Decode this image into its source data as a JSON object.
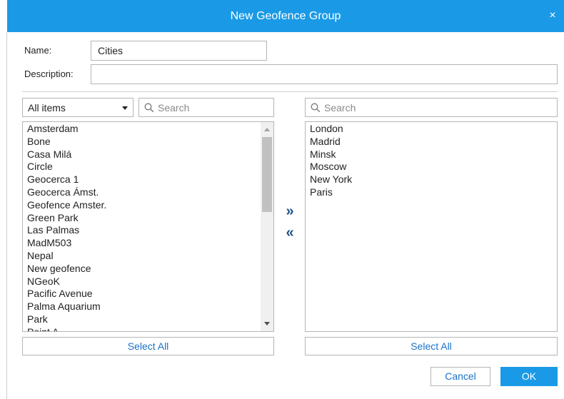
{
  "dialog": {
    "title": "New Geofence Group",
    "close_glyph": "×"
  },
  "form": {
    "name_label": "Name:",
    "name_value": "Cities",
    "description_label": "Description:",
    "description_value": ""
  },
  "left_panel": {
    "filter_selected": "All items",
    "search_placeholder": "Search",
    "items": [
      "Amsterdam",
      "Bone",
      "Casa Milá",
      "Circle",
      "Geocerca 1",
      "Geocerca Ámst.",
      "Geofence Amster.",
      "Green Park",
      "Las Palmas",
      "MadM503",
      "Nepal",
      "New geofence",
      "NGeoK",
      "Pacific Avenue",
      "Palma Aquarium",
      "Park",
      "Point A"
    ],
    "select_all_label": "Select All",
    "scrollbar": {
      "position_fraction": 0.0
    }
  },
  "transfer": {
    "add_glyph": "»",
    "remove_glyph": "«"
  },
  "right_panel": {
    "search_placeholder": "Search",
    "items": [
      "London",
      "Madrid",
      "Minsk",
      "Moscow",
      "New York",
      "Paris"
    ],
    "select_all_label": "Select All"
  },
  "footer": {
    "cancel_label": "Cancel",
    "ok_label": "OK"
  },
  "icons": {
    "search": "search-icon",
    "close": "close-icon",
    "dropdown": "chevron-down-icon"
  },
  "colors": {
    "accent": "#1a9ae6",
    "link_text": "#1a72c7",
    "arrow": "#1e4f8a"
  }
}
